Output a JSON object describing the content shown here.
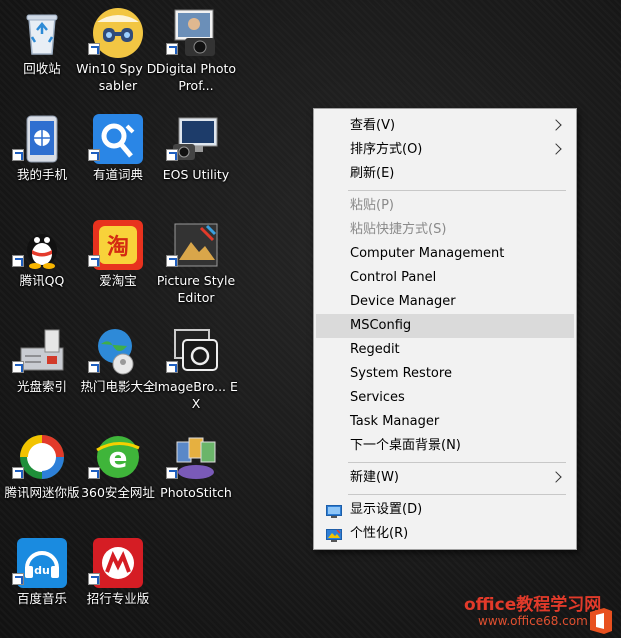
{
  "desktop": {
    "icons": [
      {
        "label": "回收站",
        "name": "recycle-bin-icon"
      },
      {
        "label": "Win10 Spy Disabler",
        "name": "win10-spy-disabler-icon"
      },
      {
        "label": "Digital Photo Prof...",
        "name": "digital-photo-professional-icon"
      },
      {
        "label": "我的手机",
        "name": "my-phone-icon"
      },
      {
        "label": "有道词典",
        "name": "youdao-dictionary-icon"
      },
      {
        "label": "EOS Utility",
        "name": "eos-utility-icon"
      },
      {
        "label": "腾讯QQ",
        "name": "tencent-qq-icon"
      },
      {
        "label": "爱淘宝",
        "name": "ai-taobao-icon"
      },
      {
        "label": "Picture Style Editor",
        "name": "picture-style-editor-icon"
      },
      {
        "label": "光盘索引",
        "name": "disc-index-icon"
      },
      {
        "label": "热门电影大全",
        "name": "popular-movies-icon"
      },
      {
        "label": "ImageBro... EX",
        "name": "imagebrowser-ex-icon"
      },
      {
        "label": "腾讯网迷你版",
        "name": "tencent-mini-icon"
      },
      {
        "label": "360安全网址",
        "name": "360-safe-nav-icon"
      },
      {
        "label": "PhotoStitch",
        "name": "photostitch-icon"
      },
      {
        "label": "百度音乐",
        "name": "baidu-music-icon"
      },
      {
        "label": "招行专业版",
        "name": "cmb-pro-icon"
      }
    ]
  },
  "context_menu": {
    "view": "查看(V)",
    "sort": "排序方式(O)",
    "refresh": "刷新(E)",
    "paste": "粘贴(P)",
    "paste_shortcut": "粘贴快捷方式(S)",
    "computer_management": "Computer Management",
    "control_panel": "Control Panel",
    "device_manager": "Device Manager",
    "msconfig": "MSConfig",
    "regedit": "Regedit",
    "system_restore": "System Restore",
    "services": "Services",
    "task_manager": "Task Manager",
    "next_background": "下一个桌面背景(N)",
    "new": "新建(W)",
    "display_settings": "显示设置(D)",
    "personalize": "个性化(R)"
  },
  "watermark": {
    "title": "office教程学习网",
    "url": "www.office68.com"
  },
  "colors": {
    "menu_bg": "#f2f2f2",
    "menu_highlight": "#dadada",
    "disabled_text": "#8a8a8a",
    "watermark": "#e23a2a"
  }
}
